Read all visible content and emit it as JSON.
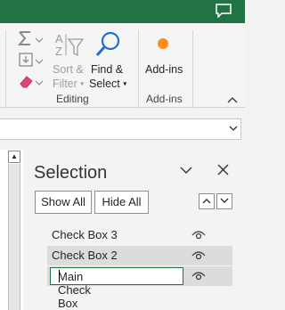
{
  "ribbon": {
    "sort_filter": {
      "line1": "Sort &",
      "line2": "Filter"
    },
    "find_select": {
      "line1": "Find &",
      "line2": "Select"
    },
    "add_ins": "Add-ins",
    "groups": {
      "editing": "Editing",
      "add_ins": "Add-ins"
    }
  },
  "pane": {
    "title": "Selection",
    "show_all": "Show All",
    "hide_all": "Hide All",
    "items": [
      {
        "label": "Check Box 3"
      },
      {
        "label": "Check Box 2"
      },
      {
        "label": "Main Check Box"
      }
    ]
  },
  "colors": {
    "accent": "#217346",
    "addin_dot": "#ff8c1a",
    "find_icon": "#1f6fd1"
  }
}
